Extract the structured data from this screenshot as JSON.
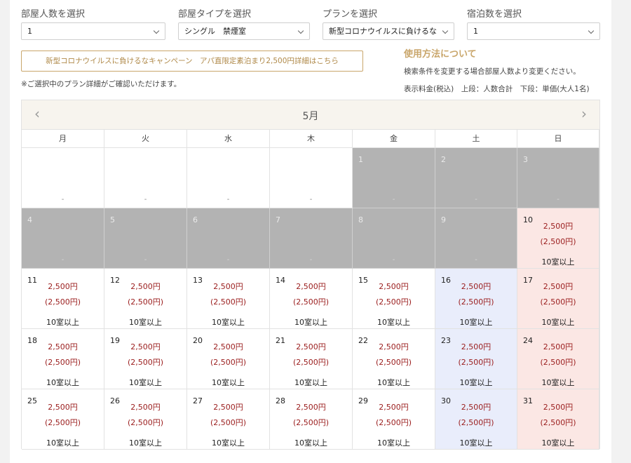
{
  "filters": [
    {
      "label": "部屋人数を選択",
      "value": "1"
    },
    {
      "label": "部屋タイプを選択",
      "value": "シングル　禁煙室"
    },
    {
      "label": "プランを選択",
      "value": "新型コロナウイルスに負けるな"
    },
    {
      "label": "宿泊数を選択",
      "value": "1"
    }
  ],
  "campaign_button": "新型コロナウイルスに負けるなキャンペーン　アパ直限定素泊まり2,500円詳細はこちら",
  "plan_note": "※ご選択中のプラン詳細がご確認いただけます。",
  "howto": {
    "title": "使用方法について",
    "text": "検索条件を変更する場合部屋人数より変更ください。",
    "price_legend": "表示料金(税込)　上段：人数合計　下段：単価(大人1名)"
  },
  "calendar": {
    "month": "5月",
    "prev": "‹",
    "next": "›",
    "weekdays": [
      "月",
      "火",
      "水",
      "木",
      "金",
      "土",
      "日"
    ],
    "price": "2,500円",
    "unit_price": "(2,500円)",
    "availability": "10室以上",
    "unavailable_mark": "-",
    "weeks": [
      [
        null,
        null,
        null,
        null,
        1,
        2,
        3
      ],
      [
        4,
        5,
        6,
        7,
        8,
        9,
        10
      ],
      [
        11,
        12,
        13,
        14,
        15,
        16,
        17
      ],
      [
        18,
        19,
        20,
        21,
        22,
        23,
        24
      ],
      [
        25,
        26,
        27,
        28,
        29,
        30,
        31
      ]
    ],
    "unavailable_days": [
      1,
      2,
      3,
      4,
      5,
      6,
      7,
      8,
      9
    ]
  }
}
